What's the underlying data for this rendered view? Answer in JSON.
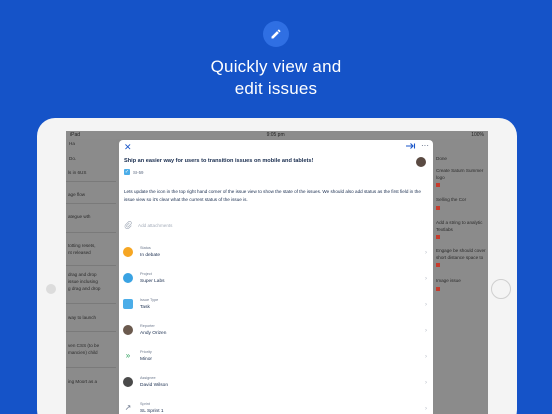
{
  "headline": {
    "line1": "Quickly view and",
    "line2": "edit issues"
  },
  "status_bar": {
    "carrier": "iPad",
    "time": "9:05 pm",
    "battery": "100%"
  },
  "background_left": [
    "Ha",
    "Do.",
    "ls in 6US",
    "age flow",
    "ategue wth",
    "totting resets,",
    "nt released",
    "drag and drop",
    "issue inclusing",
    "g drag and drop",
    "way to launch",
    "ven CSS (to be",
    "mancien) child",
    "ing Moort as a"
  ],
  "background_right": [
    "Done",
    "Create Saturn Summer",
    "logo",
    "Selling the Cor",
    "Add a string to analytic",
    "Textlabs",
    "Engage be should cover",
    "short distance space to",
    "Image issue"
  ],
  "issue": {
    "title": "Ship an easier way for users to transition issues on mobile and tablets!",
    "key": "SI-59",
    "description": "Lets update the icon in the top right hand corner of the issue view to show the state of the issues. We should also add status as the first field in the issue view so it's clear what the current status of the issue is.",
    "attachments_placeholder": "Add attachments"
  },
  "fields": [
    {
      "label": "Status",
      "value": "In debate",
      "icon": "status-icon",
      "color": "#f6a623"
    },
    {
      "label": "Project",
      "value": "Super Labs",
      "icon": "project-icon",
      "color": "#3aa3e3"
    },
    {
      "label": "Issue Type",
      "value": "Task",
      "icon": "task-icon",
      "color": "#4bade8"
    },
    {
      "label": "Reporter",
      "value": "Andy Orizen",
      "icon": "avatar-icon",
      "color": "#6b5a4e"
    },
    {
      "label": "Priority",
      "value": "Minor",
      "icon": "priority-minor-icon",
      "color": "#2a9d5a"
    },
    {
      "label": "Assignee",
      "value": "David Wilson",
      "icon": "avatar-icon",
      "color": "#4a4a4a"
    },
    {
      "label": "Sprint",
      "value": "SL Sprint 1",
      "icon": "sprint-icon",
      "color": "#6b778c"
    }
  ],
  "colors": {
    "brand": "#1553c8",
    "link": "#1a56c9"
  }
}
